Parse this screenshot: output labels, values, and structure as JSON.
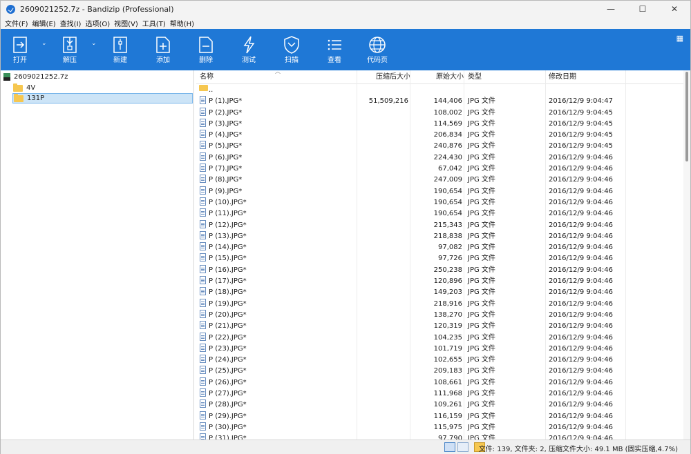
{
  "window": {
    "title": "2609021252.7z - Bandizip (Professional)",
    "minimize": "—",
    "maximize": "☐",
    "close": "✕"
  },
  "menu": [
    "文件(F)",
    "编辑(E)",
    "查找(I)",
    "选项(O)",
    "视图(V)",
    "工具(T)",
    "帮助(H)"
  ],
  "toolbar": {
    "open": "打开",
    "extract": "解压",
    "new": "新建",
    "add": "添加",
    "delete": "删除",
    "test": "测试",
    "scan": "扫描",
    "view": "查看",
    "codepage": "代码页"
  },
  "tree": {
    "archive": "2609021252.7z",
    "folders": [
      "4V",
      "131P"
    ],
    "selected_folder": "131P"
  },
  "columns": {
    "name": "名称",
    "packed": "压缩后大小",
    "original": "原始大小",
    "type": "类型",
    "modified": "修改日期"
  },
  "parent_row": "..",
  "files": [
    {
      "name": "P (1).JPG*",
      "packed": "51,509,216",
      "size": "144,406",
      "type": "JPG 文件",
      "date": "2016/12/9 9:04:47"
    },
    {
      "name": "P (2).JPG*",
      "packed": "",
      "size": "108,002",
      "type": "JPG 文件",
      "date": "2016/12/9 9:04:45"
    },
    {
      "name": "P (3).JPG*",
      "packed": "",
      "size": "114,569",
      "type": "JPG 文件",
      "date": "2016/12/9 9:04:45"
    },
    {
      "name": "P (4).JPG*",
      "packed": "",
      "size": "206,834",
      "type": "JPG 文件",
      "date": "2016/12/9 9:04:45"
    },
    {
      "name": "P (5).JPG*",
      "packed": "",
      "size": "240,876",
      "type": "JPG 文件",
      "date": "2016/12/9 9:04:45"
    },
    {
      "name": "P (6).JPG*",
      "packed": "",
      "size": "224,430",
      "type": "JPG 文件",
      "date": "2016/12/9 9:04:46"
    },
    {
      "name": "P (7).JPG*",
      "packed": "",
      "size": "67,042",
      "type": "JPG 文件",
      "date": "2016/12/9 9:04:46"
    },
    {
      "name": "P (8).JPG*",
      "packed": "",
      "size": "247,009",
      "type": "JPG 文件",
      "date": "2016/12/9 9:04:46"
    },
    {
      "name": "P (9).JPG*",
      "packed": "",
      "size": "190,654",
      "type": "JPG 文件",
      "date": "2016/12/9 9:04:46"
    },
    {
      "name": "P (10).JPG*",
      "packed": "",
      "size": "190,654",
      "type": "JPG 文件",
      "date": "2016/12/9 9:04:46"
    },
    {
      "name": "P (11).JPG*",
      "packed": "",
      "size": "190,654",
      "type": "JPG 文件",
      "date": "2016/12/9 9:04:46"
    },
    {
      "name": "P (12).JPG*",
      "packed": "",
      "size": "215,343",
      "type": "JPG 文件",
      "date": "2016/12/9 9:04:46"
    },
    {
      "name": "P (13).JPG*",
      "packed": "",
      "size": "218,838",
      "type": "JPG 文件",
      "date": "2016/12/9 9:04:46"
    },
    {
      "name": "P (14).JPG*",
      "packed": "",
      "size": "97,082",
      "type": "JPG 文件",
      "date": "2016/12/9 9:04:46"
    },
    {
      "name": "P (15).JPG*",
      "packed": "",
      "size": "97,726",
      "type": "JPG 文件",
      "date": "2016/12/9 9:04:46"
    },
    {
      "name": "P (16).JPG*",
      "packed": "",
      "size": "250,238",
      "type": "JPG 文件",
      "date": "2016/12/9 9:04:46"
    },
    {
      "name": "P (17).JPG*",
      "packed": "",
      "size": "120,896",
      "type": "JPG 文件",
      "date": "2016/12/9 9:04:46"
    },
    {
      "name": "P (18).JPG*",
      "packed": "",
      "size": "149,203",
      "type": "JPG 文件",
      "date": "2016/12/9 9:04:46"
    },
    {
      "name": "P (19).JPG*",
      "packed": "",
      "size": "218,916",
      "type": "JPG 文件",
      "date": "2016/12/9 9:04:46"
    },
    {
      "name": "P (20).JPG*",
      "packed": "",
      "size": "138,270",
      "type": "JPG 文件",
      "date": "2016/12/9 9:04:46"
    },
    {
      "name": "P (21).JPG*",
      "packed": "",
      "size": "120,319",
      "type": "JPG 文件",
      "date": "2016/12/9 9:04:46"
    },
    {
      "name": "P (22).JPG*",
      "packed": "",
      "size": "104,235",
      "type": "JPG 文件",
      "date": "2016/12/9 9:04:46"
    },
    {
      "name": "P (23).JPG*",
      "packed": "",
      "size": "101,719",
      "type": "JPG 文件",
      "date": "2016/12/9 9:04:46"
    },
    {
      "name": "P (24).JPG*",
      "packed": "",
      "size": "102,655",
      "type": "JPG 文件",
      "date": "2016/12/9 9:04:46"
    },
    {
      "name": "P (25).JPG*",
      "packed": "",
      "size": "209,183",
      "type": "JPG 文件",
      "date": "2016/12/9 9:04:46"
    },
    {
      "name": "P (26).JPG*",
      "packed": "",
      "size": "108,661",
      "type": "JPG 文件",
      "date": "2016/12/9 9:04:46"
    },
    {
      "name": "P (27).JPG*",
      "packed": "",
      "size": "111,968",
      "type": "JPG 文件",
      "date": "2016/12/9 9:04:46"
    },
    {
      "name": "P (28).JPG*",
      "packed": "",
      "size": "109,261",
      "type": "JPG 文件",
      "date": "2016/12/9 9:04:46"
    },
    {
      "name": "P (29).JPG*",
      "packed": "",
      "size": "116,159",
      "type": "JPG 文件",
      "date": "2016/12/9 9:04:46"
    },
    {
      "name": "P (30).JPG*",
      "packed": "",
      "size": "115,975",
      "type": "JPG 文件",
      "date": "2016/12/9 9:04:46"
    },
    {
      "name": "P (31).JPG*",
      "packed": "",
      "size": "97,790",
      "type": "JPG 文件",
      "date": "2016/12/9 9:04:46"
    }
  ],
  "status": {
    "text": "文件: 139, 文件夹: 2, 压缩文件大小: 49.1 MB (固实压缩,4.7%)"
  },
  "colors": {
    "toolbar": "#1f78d6",
    "selection": "#cce4f7",
    "folder": "#f6c750"
  }
}
